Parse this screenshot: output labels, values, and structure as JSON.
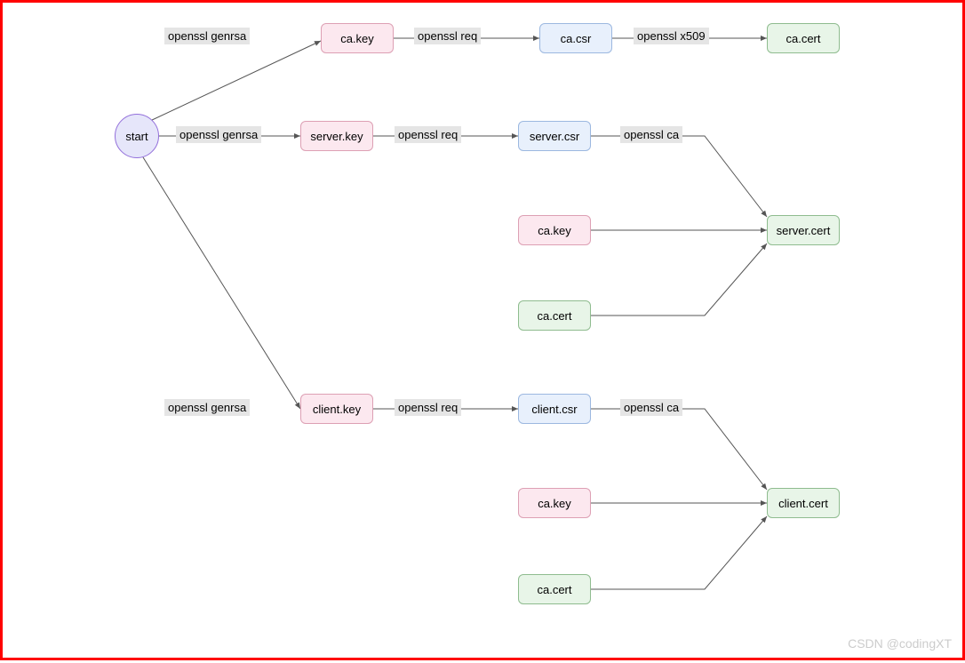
{
  "diagram": {
    "start": "start",
    "edges": {
      "genrsa1": "openssl genrsa",
      "genrsa2": "openssl genrsa",
      "genrsa3": "openssl genrsa",
      "req1": "openssl req",
      "req2": "openssl req",
      "req3": "openssl req",
      "x509": "openssl x509",
      "ca1": "openssl ca",
      "ca2": "openssl ca"
    },
    "nodes": {
      "ca_key_1": "ca.key",
      "ca_csr": "ca.csr",
      "ca_cert_1": "ca.cert",
      "server_key": "server.key",
      "server_csr": "server.csr",
      "server_cert": "server.cert",
      "ca_key_2": "ca.key",
      "ca_cert_2": "ca.cert",
      "client_key": "client.key",
      "client_csr": "client.csr",
      "client_cert": "client.cert",
      "ca_key_3": "ca.key",
      "ca_cert_3": "ca.cert"
    },
    "watermark": "CSDN @codingXT"
  }
}
